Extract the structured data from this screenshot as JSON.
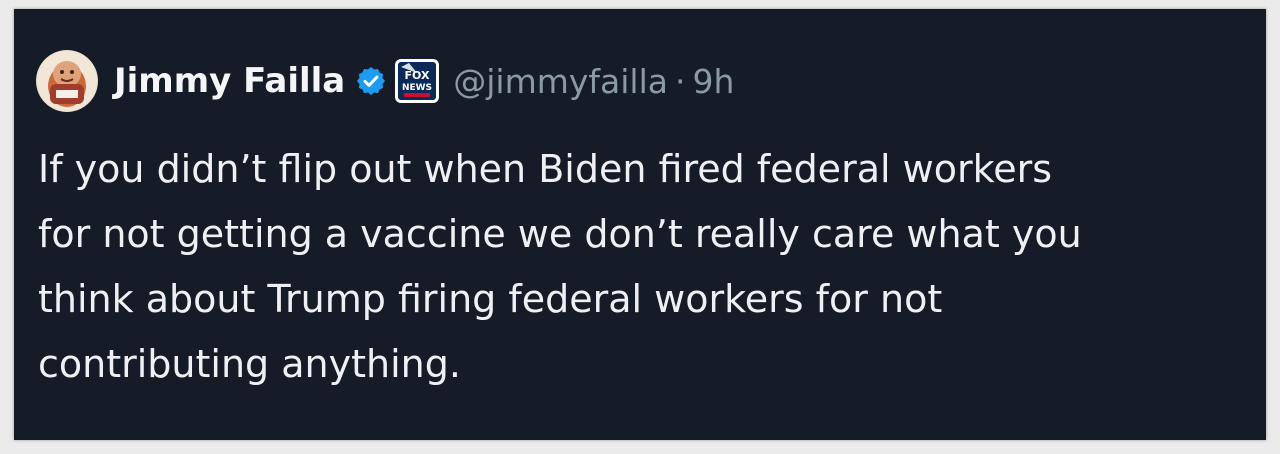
{
  "post": {
    "author_name": "Jimmy Failla",
    "handle": "@jimmyfailla",
    "separator": "·",
    "time": "9h",
    "verified_icon": "verified-badge-icon",
    "affiliate_icon": "fox-news-logo",
    "affiliate_logo_text": [
      "FOX",
      "NEWS"
    ],
    "text_lines": [
      "If you didn’t flip out when Biden fired federal workers",
      "for not getting a vaccine we don’t really care what you",
      "think about Trump firing federal workers for not",
      "contributing anything."
    ]
  },
  "colors": {
    "background": "#161c27",
    "name": "#f4f5f7",
    "muted": "#8b98a5",
    "verified": "#1d9bf0"
  }
}
